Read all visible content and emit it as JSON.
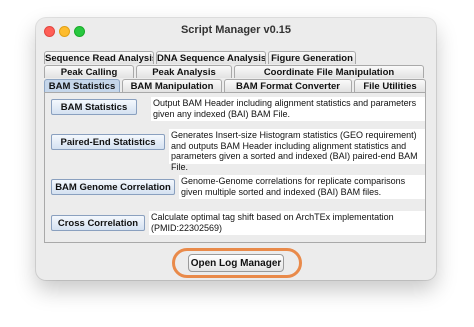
{
  "window": {
    "title": "Script Manager v0.15"
  },
  "tabs": {
    "row1": [
      "Sequence Read Analysis",
      "DNA Sequence Analysis",
      "Figure Generation"
    ],
    "row2": [
      "Peak Calling",
      "Peak Analysis",
      "Coordinate File Manipulation"
    ],
    "row3": [
      "BAM Statistics",
      "BAM Manipulation",
      "BAM Format Converter",
      "File Utilities"
    ],
    "selected": "BAM Statistics"
  },
  "tools": [
    {
      "label": "BAM Statistics",
      "description": "Output BAM Header including alignment statistics and parameters given any indexed (BAI) BAM File."
    },
    {
      "label": "Paired-End Statistics",
      "description": "Generates Insert-size Histogram statistics (GEO requirement) and outputs BAM Header including alignment statistics and parameters given a sorted and indexed (BAI) paired-end BAM File."
    },
    {
      "label": "BAM Genome Correlation",
      "description": "Genome-Genome correlations for replicate comparisons given multiple sorted and indexed (BAI) BAM files."
    },
    {
      "label": "Cross Correlation",
      "description": "Calculate optimal tag shift based on ArchTEx implementation (PMID:22302569)"
    }
  ],
  "footer": {
    "log_button": "Open Log Manager"
  },
  "colors": {
    "highlight": "#e98a4a",
    "selected_tab": "#c5d6ea"
  }
}
